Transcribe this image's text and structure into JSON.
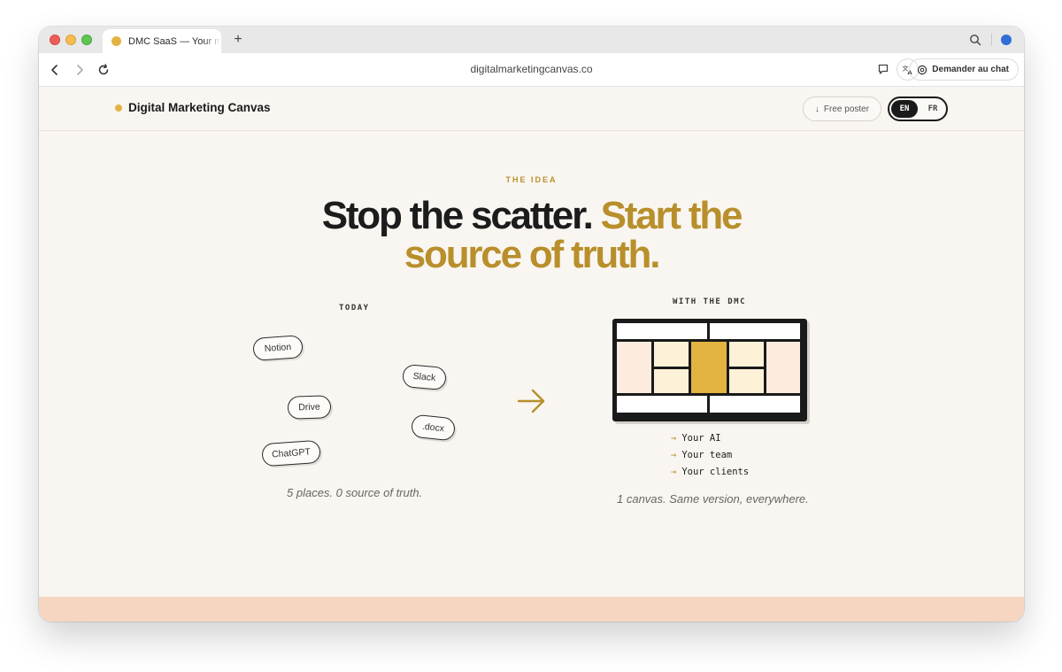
{
  "browser": {
    "tab_title": "DMC SaaS — Your marketing canvas",
    "new_tab_label": "+",
    "url": "digitalmarketingcanvas.co",
    "chat_button_label": "Demander au chat",
    "colors": {
      "close": "#ec5f59",
      "minimize": "#f4bd4f",
      "maximize": "#5fc454",
      "profile": "#2f6fd6"
    }
  },
  "site": {
    "brand_name": "Digital Marketing Canvas",
    "brand_color": "#e3b341",
    "poster_button": {
      "icon": "↓",
      "label": "Free poster"
    },
    "languages": [
      "EN",
      "FR"
    ],
    "active_language": "EN"
  },
  "hero": {
    "eyebrow": "THE IDEA",
    "headline_dark": "Stop the scatter.",
    "headline_gold": "Start the source of truth.",
    "accent_color": "#b88f2b"
  },
  "today": {
    "label": "TODAY",
    "tools": [
      "Notion",
      "Slack",
      "Drive",
      ".docx",
      "ChatGPT"
    ],
    "caption": "5 places. 0 source of truth."
  },
  "with_dmc": {
    "label": "WITH THE DMC",
    "bullet_mark": "→",
    "bullets": [
      "Your AI",
      "Your team",
      "Your clients"
    ],
    "caption": "1 canvas. Same version, everywhere."
  }
}
